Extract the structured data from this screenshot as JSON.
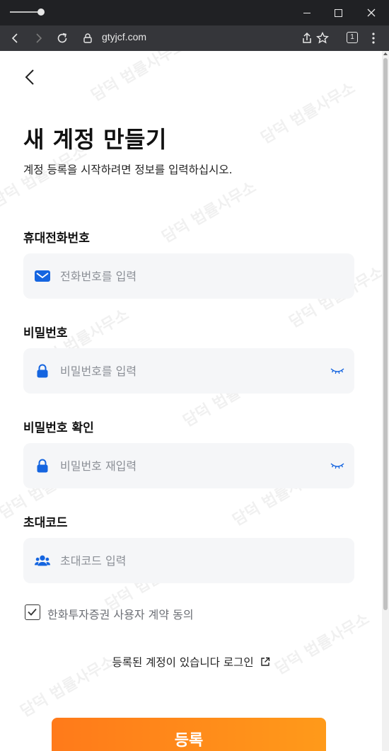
{
  "browser": {
    "url": "gtyjcf.com",
    "tab_count": "1"
  },
  "page": {
    "title": "새 계정 만들기",
    "subtitle": "계정 등록을 시작하려면 정보를 입력하십시오.",
    "fields": [
      {
        "label": "휴대전화번호",
        "placeholder": "전화번호를 입력",
        "icon": "envelope-icon"
      },
      {
        "label": "비밀번호",
        "placeholder": "비밀번호를 입력",
        "icon": "lock-icon"
      },
      {
        "label": "비밀번호 확인",
        "placeholder": "비밀번호 재입력",
        "icon": "lock-icon"
      },
      {
        "label": "초대코드",
        "placeholder": "초대코드 입력",
        "icon": "users-icon"
      }
    ],
    "agreement": {
      "text": "한화투자증권 사용자 계약 동의",
      "checked": true
    },
    "login_text": "등록된 계정이 있습니다 로그인",
    "register_label": "등록"
  },
  "watermark": "담덕 법률사무소",
  "colors": {
    "accent": "#ff8a1a",
    "icon_blue": "#1565e0",
    "field_bg": "#f5f6f8"
  }
}
